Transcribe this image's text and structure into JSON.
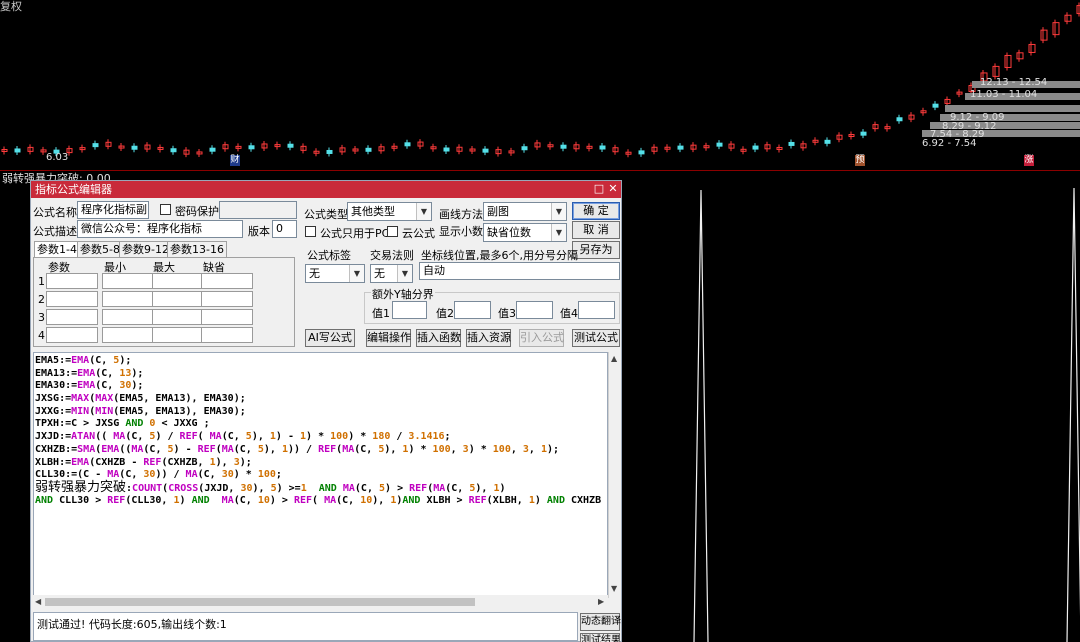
{
  "top_chart": {
    "title": "复权",
    "price_low": "6.03",
    "vp_labels": [
      "12.13 - 12.54",
      "11.03 - 11.04",
      "9.12 - 9.09",
      "8.29 - 9.12",
      "7.54 - 8.29",
      "6.92 - 7.54"
    ],
    "markers": [
      "财",
      "预",
      "涨"
    ],
    "colors": {
      "up": "#ff3b3b",
      "down": "#54e0e8",
      "volume_profile": "#8a8a8a"
    }
  },
  "indicator": {
    "name": "弱转强暴力突破",
    "value": "0.00",
    "title_text": "弱转强暴力突破: 0.00"
  },
  "editor": {
    "title": "指标公式编辑器",
    "name_label": "公式名称",
    "name_value": "程序化指标副",
    "password_label": "密码保护",
    "desc_label": "公式描述",
    "desc_value": "微信公众号：程序化指标",
    "version_label": "版本",
    "version_value": "0",
    "type_label": "公式类型",
    "type_value": "其他类型",
    "draw_label": "画线方法",
    "draw_value": "副图",
    "pc_only_label": "公式只用于PC",
    "cloud_label": "云公式",
    "decimals_label": "显示小数",
    "decimals_value": "缺省位数",
    "ok_label": "确  定",
    "cancel_label": "取  消",
    "saveas_label": "另存为",
    "tabs": [
      "参数1-4",
      "参数5-8",
      "参数9-12",
      "参数13-16"
    ],
    "param_headers": [
      "参数",
      "最小",
      "最大",
      "缺省"
    ],
    "param_rows": [
      "1",
      "2",
      "3",
      "4"
    ],
    "formula_tag_label": "公式标签",
    "formula_tag_value": "无",
    "trade_rule_label": "交易法则",
    "trade_rule_value": "无",
    "coord_label": "坐标线位置,最多6个,用分号分隔",
    "coord_value": "自动",
    "yaxis_group_label": "额外Y轴分界",
    "yaxis_values": [
      "值1",
      "值2",
      "值3",
      "值4"
    ],
    "buttons": [
      "AI写公式",
      "编辑操作",
      "插入函数",
      "插入资源",
      "引入公式",
      "测试公式"
    ],
    "status_text": "测试通过! 代码长度:605,输出线个数:1",
    "side_buttons": [
      "动态翻译",
      "测试结果"
    ]
  },
  "code_lines": [
    [
      [
        "EMA5:=",
        "bk"
      ],
      [
        "EMA",
        "fn"
      ],
      [
        "(C, ",
        "bk"
      ],
      [
        "5",
        "num"
      ],
      [
        ");",
        "bk"
      ]
    ],
    [
      [
        "EMA13:=",
        "bk"
      ],
      [
        "EMA",
        "fn"
      ],
      [
        "(C, ",
        "bk"
      ],
      [
        "13",
        "num"
      ],
      [
        ");",
        "bk"
      ]
    ],
    [
      [
        "EMA30:=",
        "bk"
      ],
      [
        "EMA",
        "fn"
      ],
      [
        "(C, ",
        "bk"
      ],
      [
        "30",
        "num"
      ],
      [
        ");",
        "bk"
      ]
    ],
    [
      [
        "JXSG:=",
        "bk"
      ],
      [
        "MAX",
        "fn"
      ],
      [
        "(",
        "bk"
      ],
      [
        "MAX",
        "fn"
      ],
      [
        "(EMA5, EMA13), EMA30);",
        "bk"
      ]
    ],
    [
      [
        "JXXG:=",
        "bk"
      ],
      [
        "MIN",
        "fn"
      ],
      [
        "(",
        "bk"
      ],
      [
        "MIN",
        "fn"
      ],
      [
        "(EMA5, EMA13), EMA30);",
        "bk"
      ]
    ],
    [
      [
        "TPXH:=C > JXSG ",
        "bk"
      ],
      [
        "AND",
        "kw"
      ],
      [
        " ",
        "bk"
      ],
      [
        "0",
        "num"
      ],
      [
        " < JXXG ;",
        "bk"
      ]
    ],
    [
      [
        "JXJD:=",
        "bk"
      ],
      [
        "ATAN",
        "fn"
      ],
      [
        "(( ",
        "bk"
      ],
      [
        "MA",
        "fn"
      ],
      [
        "(C, ",
        "bk"
      ],
      [
        "5",
        "num"
      ],
      [
        ") / ",
        "bk"
      ],
      [
        "REF",
        "fn"
      ],
      [
        "( ",
        "bk"
      ],
      [
        "MA",
        "fn"
      ],
      [
        "(C, ",
        "bk"
      ],
      [
        "5",
        "num"
      ],
      [
        "), ",
        "bk"
      ],
      [
        "1",
        "num"
      ],
      [
        ") - ",
        "bk"
      ],
      [
        "1",
        "num"
      ],
      [
        ") * ",
        "bk"
      ],
      [
        "100",
        "num"
      ],
      [
        ") * ",
        "bk"
      ],
      [
        "180",
        "num"
      ],
      [
        " / ",
        "bk"
      ],
      [
        "3.1416",
        "num"
      ],
      [
        ";",
        "bk"
      ]
    ],
    [
      [
        "CXHZB:=",
        "bk"
      ],
      [
        "SMA",
        "fn"
      ],
      [
        "(",
        "bk"
      ],
      [
        "EMA",
        "fn"
      ],
      [
        "((",
        "bk"
      ],
      [
        "MA",
        "fn"
      ],
      [
        "(C, ",
        "bk"
      ],
      [
        "5",
        "num"
      ],
      [
        ") - ",
        "bk"
      ],
      [
        "REF",
        "fn"
      ],
      [
        "(",
        "bk"
      ],
      [
        "MA",
        "fn"
      ],
      [
        "(C, ",
        "bk"
      ],
      [
        "5",
        "num"
      ],
      [
        "), ",
        "bk"
      ],
      [
        "1",
        "num"
      ],
      [
        ")) / ",
        "bk"
      ],
      [
        "REF",
        "fn"
      ],
      [
        "(",
        "bk"
      ],
      [
        "MA",
        "fn"
      ],
      [
        "(C, ",
        "bk"
      ],
      [
        "5",
        "num"
      ],
      [
        "), ",
        "bk"
      ],
      [
        "1",
        "num"
      ],
      [
        ") * ",
        "bk"
      ],
      [
        "100",
        "num"
      ],
      [
        ", ",
        "bk"
      ],
      [
        "3",
        "num"
      ],
      [
        ") * ",
        "bk"
      ],
      [
        "100",
        "num"
      ],
      [
        ", ",
        "bk"
      ],
      [
        "3",
        "num"
      ],
      [
        ", ",
        "bk"
      ],
      [
        "1",
        "num"
      ],
      [
        ");",
        "bk"
      ]
    ],
    [
      [
        "XLBH:=",
        "bk"
      ],
      [
        "EMA",
        "fn"
      ],
      [
        "(CXHZB - ",
        "bk"
      ],
      [
        "REF",
        "fn"
      ],
      [
        "(CXHZB, ",
        "bk"
      ],
      [
        "1",
        "num"
      ],
      [
        "), ",
        "bk"
      ],
      [
        "3",
        "num"
      ],
      [
        ");",
        "bk"
      ]
    ],
    [
      [
        "CLL30:=(C - ",
        "bk"
      ],
      [
        "MA",
        "fn"
      ],
      [
        "(C, ",
        "bk"
      ],
      [
        "30",
        "num"
      ],
      [
        ")) / ",
        "bk"
      ],
      [
        "MA",
        "fn"
      ],
      [
        "(C, ",
        "bk"
      ],
      [
        "30",
        "num"
      ],
      [
        ") * ",
        "bk"
      ],
      [
        "100",
        "num"
      ],
      [
        ";",
        "bk"
      ]
    ],
    [
      [
        "弱转强暴力突破",
        "cn"
      ],
      [
        ":",
        "bk"
      ],
      [
        "COUNT",
        "fn"
      ],
      [
        "(",
        "bk"
      ],
      [
        "CROSS",
        "fn"
      ],
      [
        "(JXJD, ",
        "bk"
      ],
      [
        "30",
        "num"
      ],
      [
        "), ",
        "bk"
      ],
      [
        "5",
        "num"
      ],
      [
        ") >=",
        "bk"
      ],
      [
        "1",
        "num"
      ],
      [
        "  ",
        "bk"
      ],
      [
        "AND",
        "kw"
      ],
      [
        " ",
        "bk"
      ],
      [
        "MA",
        "fn"
      ],
      [
        "(C, ",
        "bk"
      ],
      [
        "5",
        "num"
      ],
      [
        ") > ",
        "bk"
      ],
      [
        "REF",
        "fn"
      ],
      [
        "(",
        "bk"
      ],
      [
        "MA",
        "fn"
      ],
      [
        "(C, ",
        "bk"
      ],
      [
        "5",
        "num"
      ],
      [
        "), ",
        "bk"
      ],
      [
        "1",
        "num"
      ],
      [
        ")",
        "bk"
      ]
    ],
    [
      [
        "AND",
        "kw"
      ],
      [
        " CLL30 > ",
        "bk"
      ],
      [
        "REF",
        "fn"
      ],
      [
        "(CLL30, ",
        "bk"
      ],
      [
        "1",
        "num"
      ],
      [
        ") ",
        "bk"
      ],
      [
        "AND",
        "kw"
      ],
      [
        "  ",
        "bk"
      ],
      [
        "MA",
        "fn"
      ],
      [
        "(C, ",
        "bk"
      ],
      [
        "10",
        "num"
      ],
      [
        ") > ",
        "bk"
      ],
      [
        "REF",
        "fn"
      ],
      [
        "( ",
        "bk"
      ],
      [
        "MA",
        "fn"
      ],
      [
        "(C, ",
        "bk"
      ],
      [
        "10",
        "num"
      ],
      [
        "), ",
        "bk"
      ],
      [
        "1",
        "num"
      ],
      [
        ")",
        "bk"
      ],
      [
        "AND",
        "kw"
      ],
      [
        " XLBH > ",
        "bk"
      ],
      [
        "REF",
        "fn"
      ],
      [
        "(XLBH, ",
        "bk"
      ],
      [
        "1",
        "num"
      ],
      [
        ") ",
        "bk"
      ],
      [
        "AND",
        "kw"
      ],
      [
        " CXHZB",
        "bk"
      ]
    ]
  ]
}
